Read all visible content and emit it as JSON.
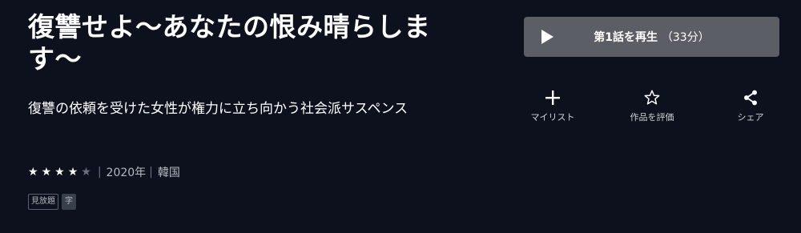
{
  "title": "復讐せよ～あなたの恨み晴らします～",
  "description": "復讐の依頼を受けた女性が権力に立ち向かう社会派サスペンス",
  "rating": {
    "filled": 4,
    "total": 5
  },
  "year": "2020年",
  "country": "韓国",
  "badges": [
    "見放題",
    "字"
  ],
  "play": {
    "label": "第1話を再生",
    "duration": "（33分）"
  },
  "actions": [
    {
      "label": "マイリスト",
      "icon": "plus-icon"
    },
    {
      "label": "作品を評価",
      "icon": "star-outline-icon"
    },
    {
      "label": "シェア",
      "icon": "share-icon"
    }
  ]
}
